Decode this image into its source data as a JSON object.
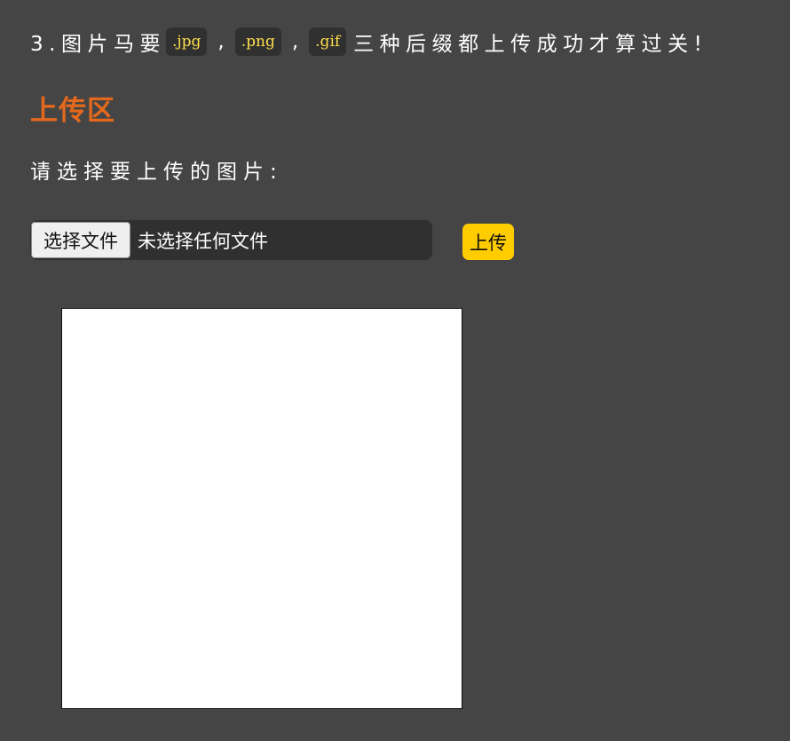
{
  "instruction": {
    "prefix": "3.图片马要",
    "ext_jpg": ".jpg",
    "comma_1": ",",
    "ext_png": ".png",
    "comma_2": ",",
    "ext_gif": ".gif",
    "suffix": "三种后缀都上传成功才算过关!"
  },
  "upload_section": {
    "title": "上传区",
    "prompt": "请选择要上传的图片:",
    "file_input": {
      "button_label": "选择文件",
      "status_text": "未选择任何文件"
    },
    "submit_label": "上传"
  },
  "colors": {
    "background": "#454545",
    "title_accent": "#e4691d",
    "code_text": "#ffde4d",
    "upload_button": "#ffcc00"
  }
}
